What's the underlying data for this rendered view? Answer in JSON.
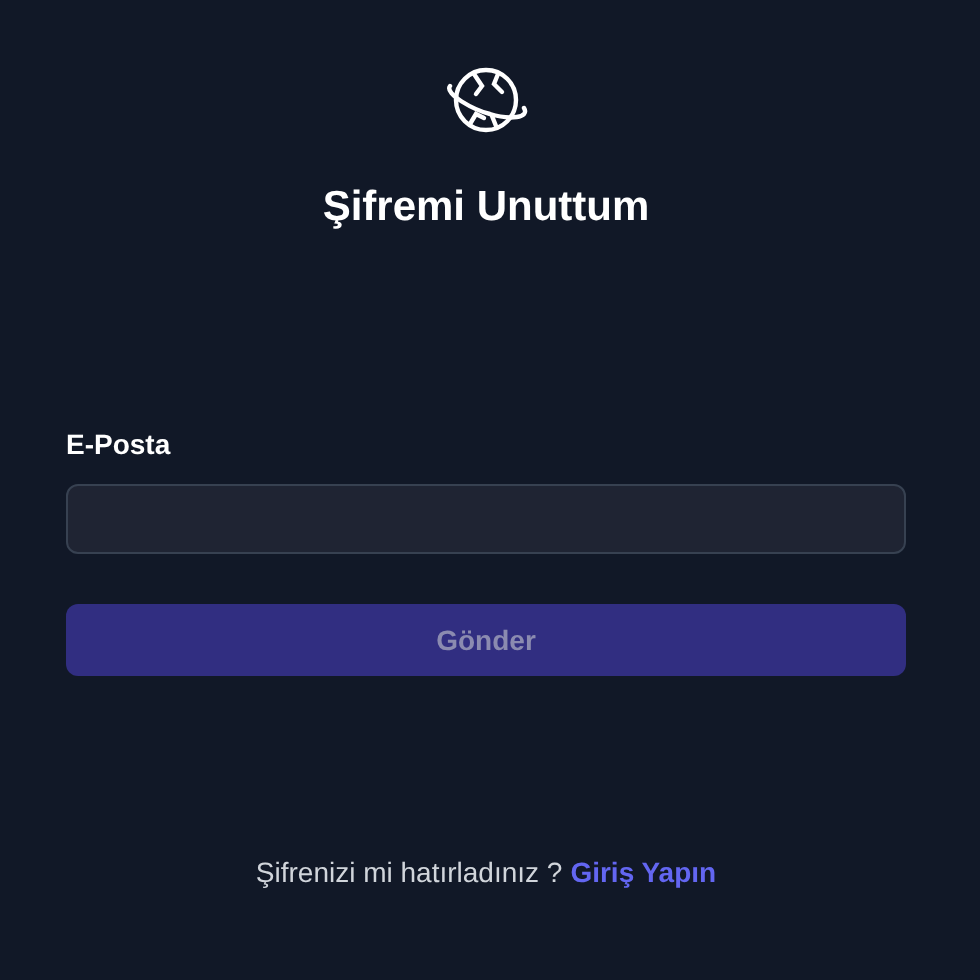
{
  "title": "Şifremi Unuttum",
  "form": {
    "email_label": "E-Posta",
    "submit": {
      "label": "Gönder",
      "disabled": true
    }
  },
  "footer": {
    "prompt": "Şifrenizi mi hatırladınız ?",
    "link": "Giriş Yapın"
  }
}
